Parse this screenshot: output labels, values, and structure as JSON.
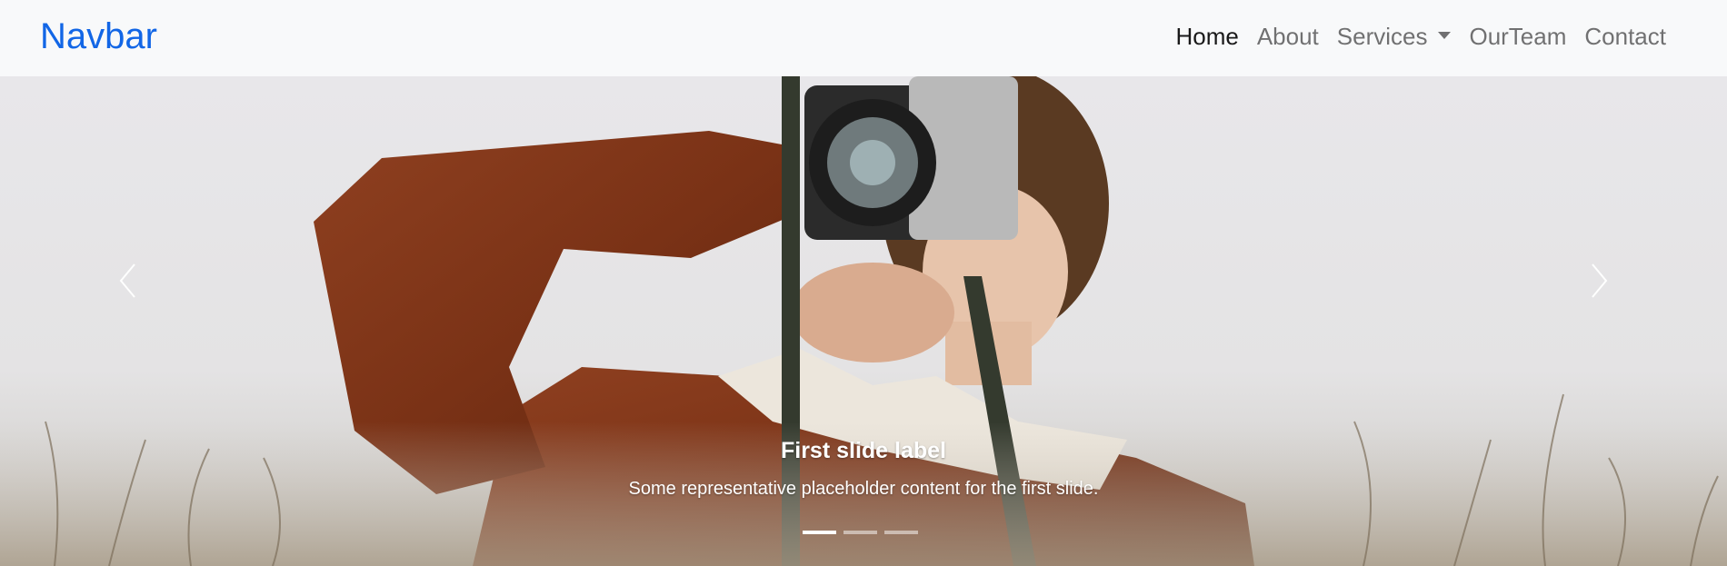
{
  "navbar": {
    "brand": "Navbar",
    "links": [
      {
        "label": "Home",
        "active": true
      },
      {
        "label": "About"
      },
      {
        "label": "Services",
        "dropdown": true
      },
      {
        "label": "OurTeam"
      },
      {
        "label": "Contact"
      }
    ]
  },
  "carousel": {
    "slide_caption_title": "First slide label",
    "slide_caption_text": "Some representative placeholder content for the first slide.",
    "indicators_count": 3,
    "active_indicator": 1,
    "prev_icon": "chevron-left-icon",
    "next_icon": "chevron-right-icon"
  },
  "colors": {
    "brand": "#1266e6",
    "navbar_bg": "#f8f9fa",
    "jacket": "#8a3a1b",
    "sky": "#e9e9eb"
  }
}
